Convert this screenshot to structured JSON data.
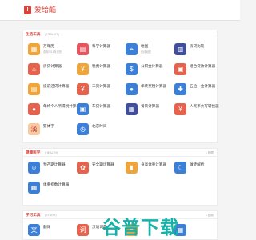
{
  "app": {
    "logo_glyph": "!",
    "title": "爱给酷"
  },
  "sections": [
    {
      "title": "生活工具",
      "subtitle": "(TOOLKIT)",
      "count": "",
      "items": [
        {
          "name": "万年历",
          "desc": "查询2015年日历",
          "icon": "calendar-icon",
          "color": "#f0a53a",
          "glyph": "▦"
        },
        {
          "name": "科学计算器",
          "desc": "",
          "icon": "calculator-icon",
          "color": "#e7555e",
          "glyph": "▤"
        },
        {
          "name": "地图",
          "desc": "在线地图",
          "icon": "map-icon",
          "color": "#3c7fd6",
          "glyph": "⌖"
        },
        {
          "name": "房贷比较",
          "desc": "",
          "icon": "building-icon",
          "color": "#3f4f9e",
          "glyph": "▥"
        },
        {
          "name": "房贷计算器",
          "desc": "",
          "icon": "house-icon",
          "color": "#e5634c",
          "glyph": "⌂"
        },
        {
          "name": "税费计算器",
          "desc": "",
          "icon": "tax-icon",
          "color": "#f0a53a",
          "glyph": "¥"
        },
        {
          "name": "公积金计算器",
          "desc": "",
          "icon": "fund-icon",
          "color": "#3c7fd6",
          "glyph": "$"
        },
        {
          "name": "组合贷款计算器",
          "desc": "",
          "icon": "loan-icon",
          "color": "#e5634c",
          "glyph": "▣"
        },
        {
          "name": "提前还贷计算器",
          "desc": "",
          "icon": "repay-icon",
          "color": "#f0a53a",
          "glyph": "▤"
        },
        {
          "name": "工资计算器",
          "desc": "",
          "icon": "salary-icon",
          "color": "#e5634c",
          "glyph": "¥"
        },
        {
          "name": "年终奖税计算器",
          "desc": "",
          "icon": "bonus-icon",
          "color": "#3c7fd6",
          "glyph": "●"
        },
        {
          "name": "五险一金计算器",
          "desc": "",
          "icon": "insurance-icon",
          "color": "#3c7fd6",
          "glyph": "✚"
        },
        {
          "name": "年终个人所得税计算器",
          "desc": "",
          "icon": "income-tax-icon",
          "color": "#e5634c",
          "glyph": "●"
        },
        {
          "name": "车贷计算器",
          "desc": "",
          "icon": "car-icon",
          "color": "#3c7fd6",
          "glyph": "▣"
        },
        {
          "name": "餐饮计算器",
          "desc": "",
          "icon": "food-icon",
          "color": "#3f4f9e",
          "glyph": "▦"
        },
        {
          "name": "人民币大写转换器",
          "desc": "",
          "icon": "yuan-icon",
          "color": "#e5634c",
          "glyph": "¥"
        },
        {
          "name": "繁体字",
          "desc": "",
          "icon": "han-char-icon",
          "color": "#f6c9a0",
          "glyph": "漢"
        },
        {
          "name": "北京时间",
          "desc": "",
          "icon": "clock-icon",
          "color": "#3c7fd6",
          "glyph": "◷"
        }
      ]
    },
    {
      "title": "健康医学",
      "subtitle": "(HEALTH)",
      "count": "1 回顾",
      "items": [
        {
          "name": "预产期计算器",
          "desc": "",
          "icon": "pregnancy-icon",
          "color": "#3c7fd6",
          "glyph": "☺"
        },
        {
          "name": "安全期计算器",
          "desc": "",
          "icon": "safe-period-icon",
          "color": "#e5634c",
          "glyph": "✿"
        },
        {
          "name": "身高体重计算器",
          "desc": "",
          "icon": "height-icon",
          "color": "#f0a53a",
          "glyph": "▮"
        },
        {
          "name": "做梦解析",
          "desc": "",
          "icon": "dream-icon",
          "color": "#3c7fd6",
          "glyph": "☾"
        },
        {
          "name": "体重指数计算器",
          "desc": "",
          "icon": "bmi-icon",
          "color": "#3c7fd6",
          "glyph": "▦"
        }
      ]
    },
    {
      "title": "学习工具",
      "subtitle": "(STUDY)",
      "count": "1 回顾",
      "items": [
        {
          "name": "翻译",
          "desc": "",
          "icon": "translate-icon",
          "color": "#3c7fd6",
          "glyph": "文"
        },
        {
          "name": "汉语词典",
          "desc": "",
          "icon": "dictionary-icon",
          "color": "#e5634c",
          "glyph": "词"
        },
        {
          "name": "",
          "desc": "",
          "icon": "cat-icon",
          "color": "#f0a53a",
          "glyph": "●"
        },
        {
          "name": "",
          "desc": "",
          "icon": "grid-icon",
          "color": "#3c7fd6",
          "glyph": "▦"
        }
      ]
    }
  ],
  "watermark": {
    "text": "谷普下载",
    "sub": ""
  }
}
